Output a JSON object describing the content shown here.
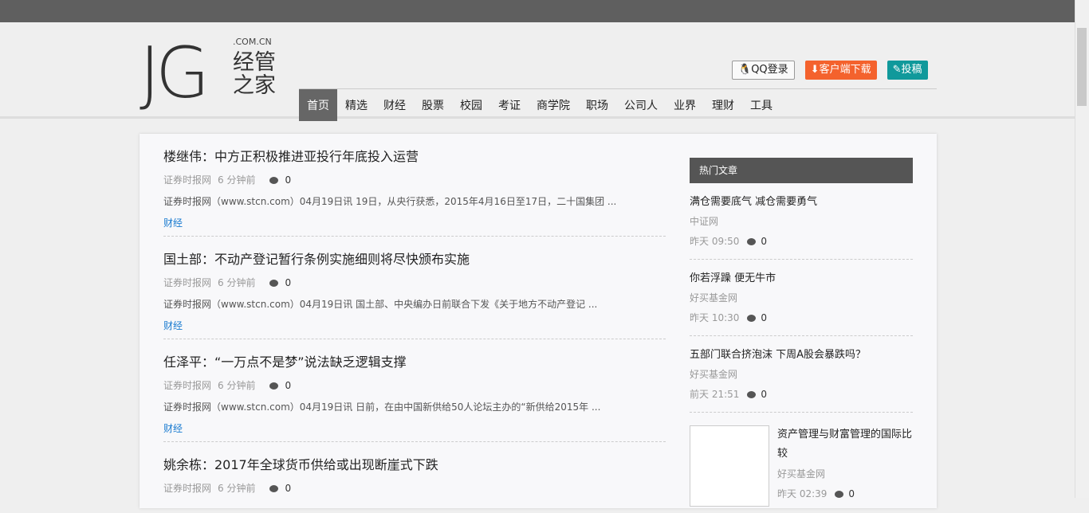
{
  "logo": {
    "mark": "JG",
    "domain": ".COM.CN",
    "name": "经管之家"
  },
  "header": {
    "qq_login": "QQ登录",
    "download": "客户端下载",
    "submit": "投稿"
  },
  "nav": [
    "首页",
    "精选",
    "财经",
    "股票",
    "校园",
    "考证",
    "商学院",
    "职场",
    "公司人",
    "业界",
    "理财",
    "工具"
  ],
  "articles": [
    {
      "title": "楼继伟：中方正积极推进亚投行年底投入运营",
      "source": "证券时报网",
      "time": "6 分钟前",
      "comments": "0",
      "excerpt": "证券时报网（www.stcn.com）04月19日讯 19日，从央行获悉，2015年4月16日至17日，二十国集团 ...",
      "category": "财经"
    },
    {
      "title": "国土部：不动产登记暂行条例实施细则将尽快颁布实施",
      "source": "证券时报网",
      "time": "6 分钟前",
      "comments": "0",
      "excerpt": "证券时报网（www.stcn.com）04月19日讯 国土部、中央编办日前联合下发《关于地方不动产登记 ...",
      "category": "财经"
    },
    {
      "title": "任泽平：“一万点不是梦”说法缺乏逻辑支撑",
      "source": "证券时报网",
      "time": "6 分钟前",
      "comments": "0",
      "excerpt": "证券时报网（www.stcn.com）04月19日讯 日前，在由中国新供给50人论坛主办的“新供给2015年 ...",
      "category": "财经"
    },
    {
      "title": "姚余栋：2017年全球货币供给或出现断崖式下跌",
      "source": "证券时报网",
      "time": "6 分钟前",
      "comments": "0"
    }
  ],
  "sidebar": {
    "title": "热门文章",
    "items": [
      {
        "title": "满仓需要底气 减仓需要勇气",
        "source": "中证网",
        "time": "昨天 09:50",
        "comments": "0"
      },
      {
        "title": "你若浮躁 便无牛市",
        "source": "好买基金网",
        "time": "昨天 10:30",
        "comments": "0"
      },
      {
        "title": "五部门联合挤泡沫 下周A股会暴跌吗？",
        "source": "好买基金网",
        "time": "前天 21:51",
        "comments": "0"
      },
      {
        "title": "资产管理与财富管理的国际比较",
        "source": "好买基金网",
        "time": "昨天 02:39",
        "comments": "0"
      }
    ]
  }
}
